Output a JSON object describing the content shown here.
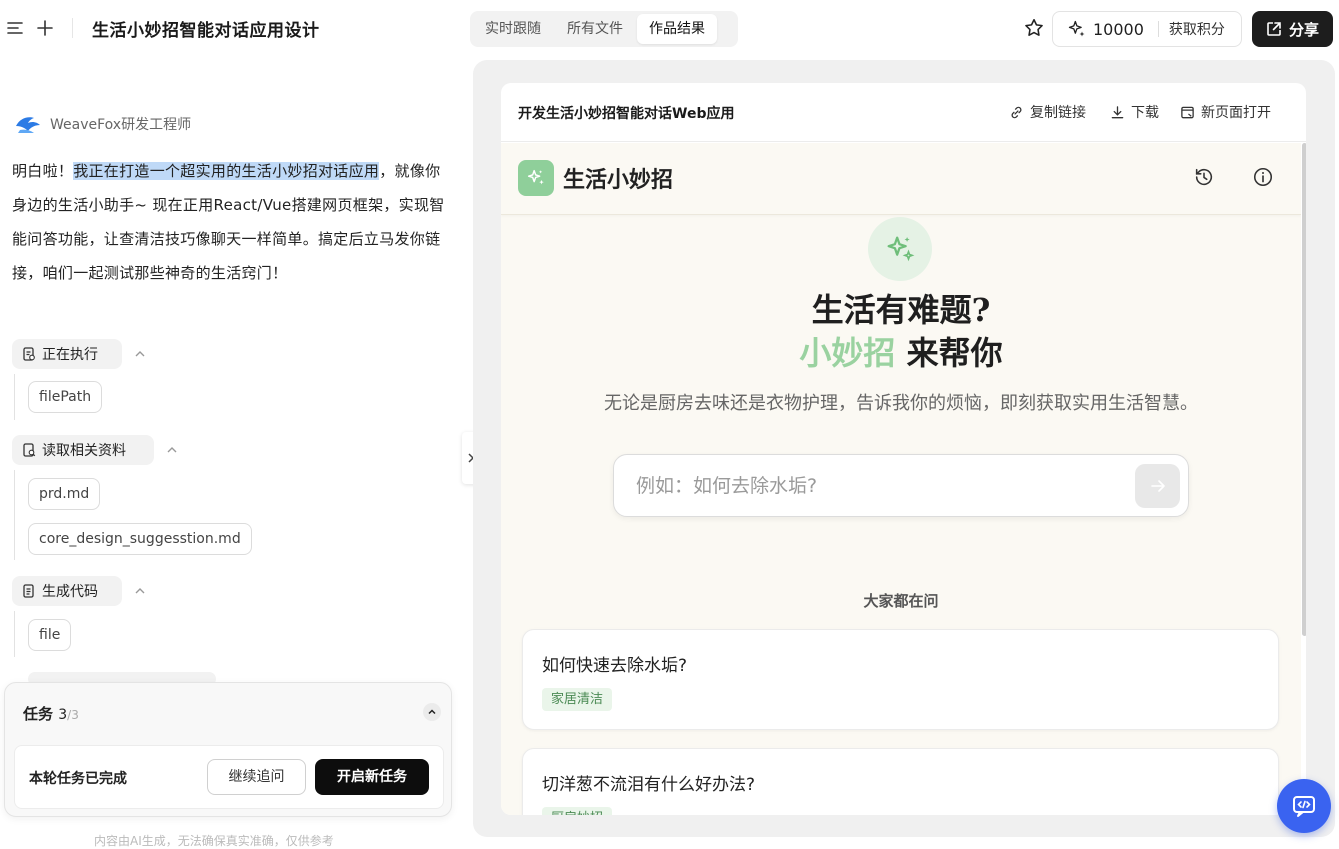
{
  "header": {
    "title": "生活小妙招智能对话应用设计",
    "tabs": [
      {
        "label": "实时跟随"
      },
      {
        "label": "所有文件"
      },
      {
        "label": "作品结果"
      }
    ],
    "credits": "10000",
    "earn_label": "获取积分",
    "share_label": "分享"
  },
  "chat": {
    "agent_name": "WeaveFox研发工程师",
    "message_prefix": "明白啦！",
    "message_highlight": "我正在打造一个超实用的生活小妙招对话应用",
    "message_rest": "，就像你身边的生活小助手~ 现在正用React/Vue搭建网页框架，实现智能问答功能，让查清洁技巧像聊天一样简单。搞定后立马发你链接，咱们一起测试那些神奇的生活窍门！",
    "steps": [
      {
        "label": "正在执行",
        "files": [
          "filePath"
        ]
      },
      {
        "label": "读取相关资料",
        "files": [
          "prd.md",
          "core_design_suggesstion.md"
        ]
      },
      {
        "label": "生成代码",
        "files": [
          "file"
        ]
      }
    ]
  },
  "task": {
    "label": "任务",
    "count": "3",
    "total": "/3",
    "status": "本轮任务已完成",
    "follow_label": "继续追问",
    "new_label": "开启新任务",
    "disclaimer": "内容由AI生成，无法确保真实准确，仅供参考"
  },
  "preview": {
    "title": "开发生活小妙招智能对话Web应用",
    "copy_link": "复制链接",
    "download": "下载",
    "open_new": "新页面打开"
  },
  "app": {
    "name": "生活小妙招",
    "hero_line1": "生活有难题?",
    "hero_accent": "小妙招",
    "hero_line2_rest": " 来帮你",
    "subtitle": "无论是厨房去味还是衣物护理，告诉我你的烦恼，即刻获取实用生活智慧。",
    "search_placeholder": "例如：如何去除水垢?",
    "popular_title": "大家都在问",
    "questions": [
      {
        "q": "如何快速去除水垢?",
        "tag": "家居清洁"
      },
      {
        "q": "切洋葱不流泪有什么好办法?",
        "tag": "厨房妙招"
      }
    ]
  },
  "colors": {
    "accent_green": "#9ad2a0",
    "logo_green": "#8fcf9a",
    "float_blue": "#3a63f0",
    "highlight": "#bfd9f7"
  }
}
